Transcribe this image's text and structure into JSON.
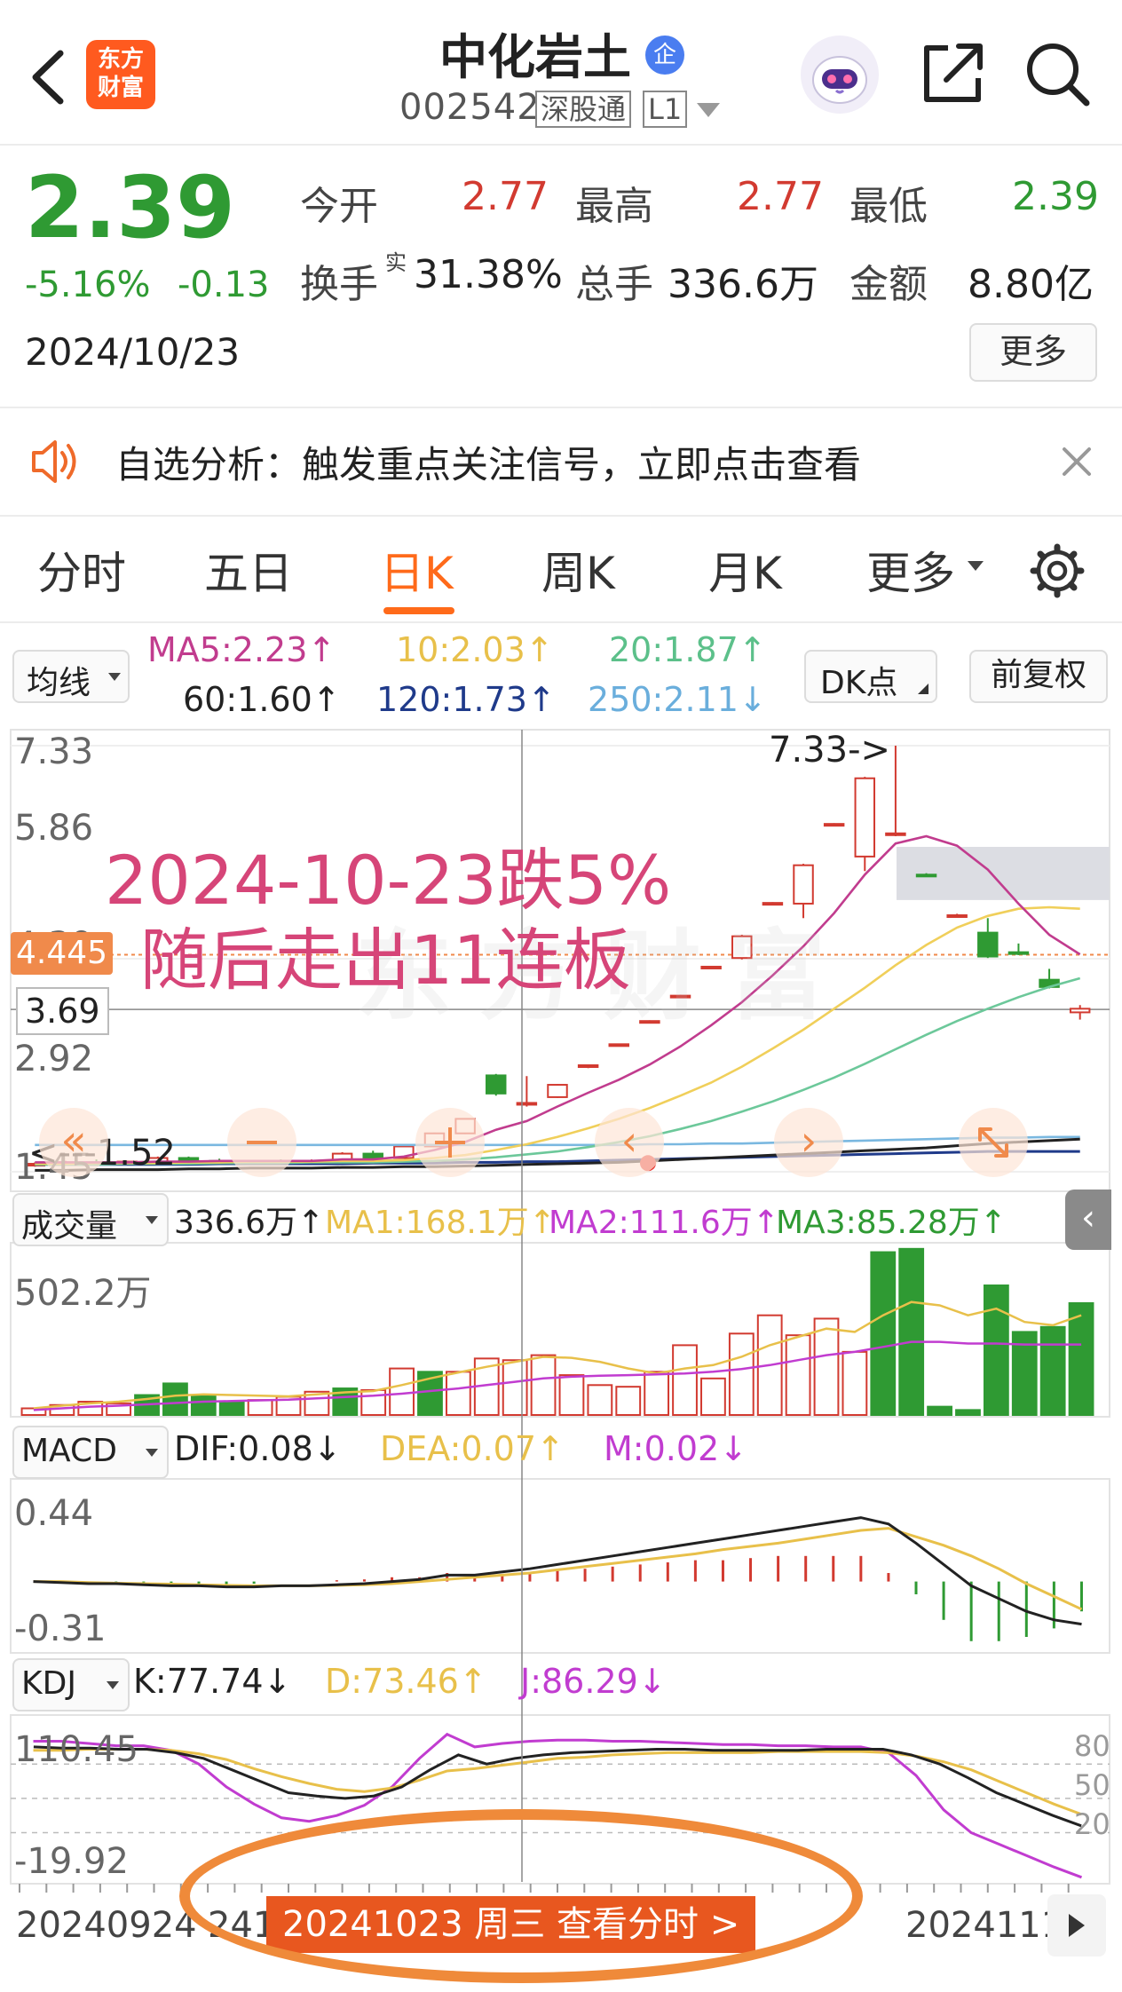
{
  "header": {
    "logo_line1": "东方",
    "logo_line2": "财富",
    "title": "中化岩土",
    "enterprise_badge": "企",
    "code": "002542",
    "tag_connect": "深股通",
    "tag_level": "L1"
  },
  "quote": {
    "price": "2.39",
    "change_pct": "-5.16%",
    "change": "-0.13",
    "date": "2024/10/23",
    "open_label": "今开",
    "open": "2.77",
    "high_label": "最高",
    "high": "2.77",
    "low_label": "最低",
    "low": "2.39",
    "turnover_label": "换手",
    "turnover_sup": "实",
    "turnover": "31.38%",
    "volume_label": "总手",
    "volume": "336.6万",
    "amount_label": "金额",
    "amount": "8.80亿",
    "more_button": "更多"
  },
  "notice": {
    "text": "自选分析：触发重点关注信号，立即点击查看"
  },
  "tabs": [
    "分时",
    "五日",
    "日K",
    "周K",
    "月K",
    "更多"
  ],
  "active_tab": "日K",
  "ma_bar": {
    "selector": "均线",
    "ma5": "MA5:2.23↑",
    "ma10": "10:2.03↑",
    "ma20": "20:1.87↑",
    "ma60": "60:1.60↑",
    "ma120": "120:1.73↑",
    "ma250": "250:2.11↓",
    "dk_button": "DK点",
    "adjust_button": "前复权"
  },
  "kline": {
    "y_labels": [
      "7.33",
      "5.86",
      "4.39",
      "2.92",
      "1.45"
    ],
    "current_tag": "4.445",
    "crosshair_value": "3.69",
    "high_marker": "7.33->",
    "low_marker": "<---1.52",
    "overlay_line1": "2024-10-23跌5%",
    "overlay_line2": "随后走出11连板",
    "watermark": "东方财富"
  },
  "volume_bar": {
    "selector": "成交量",
    "vol": "336.6万↑",
    "ma1": "MA1:168.1万↑",
    "ma2": "MA2:111.6万↑",
    "ma3": "MA3:85.28万↑",
    "y_label": "502.2万"
  },
  "macd_bar": {
    "selector": "MACD",
    "dif": "DIF:0.08↓",
    "dea": "DEA:0.07↑",
    "m": "M:0.02↓",
    "y_top": "0.44",
    "y_bottom": "-0.31"
  },
  "kdj_bar": {
    "selector": "KDJ",
    "k": "K:77.74↓",
    "d": "D:73.46↑",
    "j": "J:86.29↓",
    "y_top": "110.45",
    "y_bottom": "-19.92",
    "levels": [
      "80",
      "50",
      "20"
    ]
  },
  "footer": {
    "date_left": "20240924",
    "date_partial": "241",
    "selected_badge": "20241023 周三 查看分时 >",
    "date_right": "2024111"
  },
  "colors": {
    "up": "#d23a30",
    "down": "#2f9a33",
    "accent": "#ff6a1a",
    "ma5": "#c13c8e",
    "ma10": "#f0cf5a",
    "ma20": "#6cc89a",
    "ma60": "#222222",
    "ma120": "#1f3a8a",
    "ma250": "#7ab8e0"
  },
  "chart_data": {
    "type": "candlestick",
    "dates": [
      "20240924",
      "20241023",
      "2024111"
    ],
    "selected_date": "20241023",
    "ylim": [
      1.45,
      7.33
    ],
    "period_high": 7.33,
    "period_low": 1.52,
    "candles": [
      {
        "o": 1.54,
        "h": 1.58,
        "l": 1.52,
        "c": 1.56
      },
      {
        "o": 1.56,
        "h": 1.6,
        "l": 1.54,
        "c": 1.58
      },
      {
        "o": 1.58,
        "h": 1.62,
        "l": 1.55,
        "c": 1.57
      },
      {
        "o": 1.57,
        "h": 1.6,
        "l": 1.54,
        "c": 1.59
      },
      {
        "o": 1.59,
        "h": 1.66,
        "l": 1.58,
        "c": 1.64
      },
      {
        "o": 1.64,
        "h": 1.66,
        "l": 1.58,
        "c": 1.6
      },
      {
        "o": 1.6,
        "h": 1.63,
        "l": 1.57,
        "c": 1.58
      },
      {
        "o": 1.58,
        "h": 1.61,
        "l": 1.56,
        "c": 1.59
      },
      {
        "o": 1.59,
        "h": 1.62,
        "l": 1.56,
        "c": 1.58
      },
      {
        "o": 1.58,
        "h": 1.62,
        "l": 1.56,
        "c": 1.6
      },
      {
        "o": 1.6,
        "h": 1.72,
        "l": 1.59,
        "c": 1.7
      },
      {
        "o": 1.7,
        "h": 1.74,
        "l": 1.62,
        "c": 1.64
      },
      {
        "o": 1.64,
        "h": 1.82,
        "l": 1.63,
        "c": 1.8
      },
      {
        "o": 1.8,
        "h": 1.99,
        "l": 1.79,
        "c": 1.98
      },
      {
        "o": 1.98,
        "h": 2.19,
        "l": 1.97,
        "c": 2.18
      },
      {
        "o": 2.78,
        "h": 2.8,
        "l": 2.5,
        "c": 2.53
      },
      {
        "o": 2.39,
        "h": 2.77,
        "l": 2.35,
        "c": 2.4
      },
      {
        "o": 2.48,
        "h": 2.66,
        "l": 2.47,
        "c": 2.65
      },
      {
        "o": 2.9,
        "h": 2.93,
        "l": 2.88,
        "c": 2.92
      },
      {
        "o": 3.2,
        "h": 3.22,
        "l": 3.19,
        "c": 3.21
      },
      {
        "o": 3.52,
        "h": 3.54,
        "l": 3.51,
        "c": 3.53
      },
      {
        "o": 3.87,
        "h": 3.89,
        "l": 3.86,
        "c": 3.88
      },
      {
        "o": 4.27,
        "h": 4.29,
        "l": 4.26,
        "c": 4.28
      },
      {
        "o": 4.4,
        "h": 4.72,
        "l": 4.38,
        "c": 4.7
      },
      {
        "o": 5.15,
        "h": 5.17,
        "l": 5.14,
        "c": 5.16
      },
      {
        "o": 5.15,
        "h": 5.7,
        "l": 4.95,
        "c": 5.68
      },
      {
        "o": 6.24,
        "h": 6.26,
        "l": 6.23,
        "c": 6.25
      },
      {
        "o": 5.8,
        "h": 6.9,
        "l": 5.6,
        "c": 6.88
      },
      {
        "o": 6.1,
        "h": 7.33,
        "l": 6.08,
        "c": 6.12
      },
      {
        "o": 5.55,
        "h": 5.57,
        "l": 5.53,
        "c": 5.54
      },
      {
        "o": 4.99,
        "h": 5.01,
        "l": 4.98,
        "c": 4.99
      },
      {
        "o": 4.75,
        "h": 4.95,
        "l": 4.4,
        "c": 4.42
      },
      {
        "o": 4.48,
        "h": 4.6,
        "l": 4.44,
        "c": 4.46
      },
      {
        "o": 4.1,
        "h": 4.25,
        "l": 3.98,
        "c": 4.0
      },
      {
        "o": 3.65,
        "h": 3.75,
        "l": 3.55,
        "c": 3.7
      }
    ],
    "ma5": [
      1.58,
      1.58,
      1.58,
      1.58,
      1.59,
      1.59,
      1.6,
      1.6,
      1.6,
      1.6,
      1.62,
      1.62,
      1.66,
      1.75,
      1.86,
      2.03,
      2.15,
      2.35,
      2.54,
      2.72,
      2.93,
      3.18,
      3.47,
      3.79,
      4.16,
      4.56,
      5.02,
      5.55,
      5.98,
      6.08,
      5.95,
      5.62,
      5.15,
      4.72,
      4.45
    ],
    "ma10": [
      1.56,
      1.56,
      1.57,
      1.57,
      1.57,
      1.58,
      1.58,
      1.59,
      1.59,
      1.59,
      1.6,
      1.6,
      1.61,
      1.64,
      1.68,
      1.75,
      1.83,
      1.93,
      2.05,
      2.18,
      2.33,
      2.5,
      2.68,
      2.9,
      3.15,
      3.41,
      3.7,
      3.99,
      4.3,
      4.58,
      4.82,
      4.98,
      5.08,
      5.1,
      5.08
    ],
    "ma20": [
      1.55,
      1.55,
      1.55,
      1.56,
      1.56,
      1.56,
      1.57,
      1.57,
      1.57,
      1.58,
      1.58,
      1.58,
      1.59,
      1.6,
      1.62,
      1.65,
      1.69,
      1.73,
      1.79,
      1.86,
      1.94,
      2.04,
      2.15,
      2.28,
      2.42,
      2.58,
      2.75,
      2.94,
      3.14,
      3.34,
      3.53,
      3.7,
      3.86,
      4.0,
      4.12
    ],
    "ma60": [
      1.47,
      1.47,
      1.48,
      1.48,
      1.48,
      1.49,
      1.49,
      1.5,
      1.5,
      1.5,
      1.51,
      1.51,
      1.52,
      1.52,
      1.53,
      1.54,
      1.55,
      1.56,
      1.57,
      1.58,
      1.6,
      1.62,
      1.64,
      1.66,
      1.68,
      1.7,
      1.72,
      1.74,
      1.76,
      1.78,
      1.81,
      1.84,
      1.86,
      1.88,
      1.9
    ],
    "ma120": [
      1.55,
      1.55,
      1.55,
      1.55,
      1.55,
      1.55,
      1.56,
      1.56,
      1.56,
      1.56,
      1.56,
      1.57,
      1.57,
      1.57,
      1.58,
      1.58,
      1.59,
      1.59,
      1.6,
      1.61,
      1.62,
      1.63,
      1.64,
      1.65,
      1.66,
      1.67,
      1.68,
      1.69,
      1.7,
      1.71,
      1.72,
      1.73,
      1.73,
      1.73,
      1.73
    ],
    "ma250": [
      1.82,
      1.82,
      1.82,
      1.82,
      1.82,
      1.82,
      1.82,
      1.82,
      1.82,
      1.82,
      1.82,
      1.82,
      1.82,
      1.82,
      1.82,
      1.82,
      1.82,
      1.82,
      1.82,
      1.82,
      1.83,
      1.83,
      1.84,
      1.84,
      1.85,
      1.86,
      1.87,
      1.88,
      1.89,
      1.9,
      1.91,
      1.92,
      1.92,
      1.93,
      1.93
    ],
    "volume_wan": [
      20,
      30,
      40,
      35,
      60,
      95,
      60,
      40,
      45,
      55,
      70,
      80,
      75,
      140,
      130,
      130,
      170,
      165,
      180,
      120,
      90,
      85,
      130,
      210,
      110,
      245,
      300,
      240,
      290,
      190,
      490,
      500,
      25,
      15,
      390,
      250,
      265,
      336.6
    ],
    "volume_ylim": [
      0,
      502.2
    ],
    "vol_ma1": [
      20,
      28,
      35,
      40,
      48,
      58,
      62,
      60,
      58,
      56,
      62,
      68,
      72,
      90,
      110,
      128,
      145,
      160,
      175,
      172,
      160,
      140,
      125,
      140,
      150,
      175,
      210,
      235,
      260,
      250,
      300,
      340,
      330,
      300,
      320,
      280,
      270,
      300
    ],
    "vol_ma2": [
      15,
      20,
      25,
      28,
      32,
      36,
      40,
      42,
      44,
      46,
      50,
      54,
      58,
      64,
      72,
      80,
      90,
      100,
      110,
      115,
      118,
      120,
      122,
      125,
      130,
      138,
      150,
      165,
      180,
      190,
      205,
      220,
      220,
      215,
      215,
      212,
      212,
      212
    ],
    "macd_ylim": [
      -0.31,
      0.44
    ],
    "dif": [
      0.0,
      -0.005,
      -0.01,
      -0.01,
      -0.015,
      -0.02,
      -0.02,
      -0.025,
      -0.025,
      -0.02,
      -0.02,
      -0.015,
      -0.01,
      0.0,
      0.01,
      0.03,
      0.03,
      0.045,
      0.06,
      0.08,
      0.1,
      0.12,
      0.14,
      0.16,
      0.18,
      0.2,
      0.22,
      0.24,
      0.26,
      0.28,
      0.3,
      0.27,
      0.18,
      0.08,
      -0.02,
      -0.08,
      -0.14,
      -0.18,
      -0.2
    ],
    "dea": [
      0.0,
      0.0,
      -0.005,
      -0.008,
      -0.01,
      -0.012,
      -0.015,
      -0.018,
      -0.02,
      -0.02,
      -0.02,
      -0.018,
      -0.015,
      -0.01,
      0.0,
      0.01,
      0.02,
      0.03,
      0.04,
      0.055,
      0.07,
      0.085,
      0.1,
      0.115,
      0.13,
      0.15,
      0.165,
      0.18,
      0.2,
      0.22,
      0.24,
      0.25,
      0.21,
      0.17,
      0.12,
      0.06,
      -0.01,
      -0.07,
      -0.13
    ],
    "macd_hist": [
      0.0,
      -0.01,
      -0.01,
      -0.005,
      -0.01,
      -0.016,
      -0.01,
      -0.014,
      -0.01,
      0.0,
      0.0,
      0.006,
      0.01,
      0.02,
      0.02,
      0.04,
      0.02,
      0.03,
      0.04,
      0.05,
      0.06,
      0.07,
      0.08,
      0.09,
      0.1,
      0.1,
      0.11,
      0.12,
      0.12,
      0.12,
      0.12,
      0.04,
      -0.06,
      -0.18,
      -0.28,
      -0.28,
      -0.26,
      -0.22,
      -0.14
    ],
    "kdj_ylim": [
      -19.92,
      110.45
    ],
    "kdj_levels": [
      80,
      50,
      20
    ],
    "k": [
      95,
      94,
      94,
      93,
      93,
      90,
      85,
      75,
      65,
      55,
      52,
      50,
      52,
      60,
      75,
      88,
      80,
      85,
      88,
      90,
      91,
      92,
      93,
      93,
      92,
      92,
      92,
      92,
      93,
      93,
      93,
      88,
      80,
      68,
      55,
      45,
      35,
      26
    ],
    "d": [
      92,
      92,
      93,
      93,
      93,
      92,
      89,
      84,
      76,
      69,
      63,
      58,
      56,
      59,
      66,
      74,
      76,
      79,
      82,
      85,
      86,
      88,
      89,
      90,
      90,
      90,
      90,
      91,
      91,
      91,
      91,
      90,
      87,
      82,
      75,
      65,
      55,
      45,
      36
    ],
    "j": [
      100,
      100,
      98,
      96,
      96,
      92,
      80,
      60,
      45,
      33,
      30,
      35,
      44,
      60,
      85,
      106,
      95,
      98,
      100,
      101,
      101,
      100,
      100,
      99,
      98,
      97,
      97,
      96,
      96,
      95,
      95,
      90,
      70,
      40,
      20,
      10,
      0,
      -10,
      -19
    ]
  }
}
